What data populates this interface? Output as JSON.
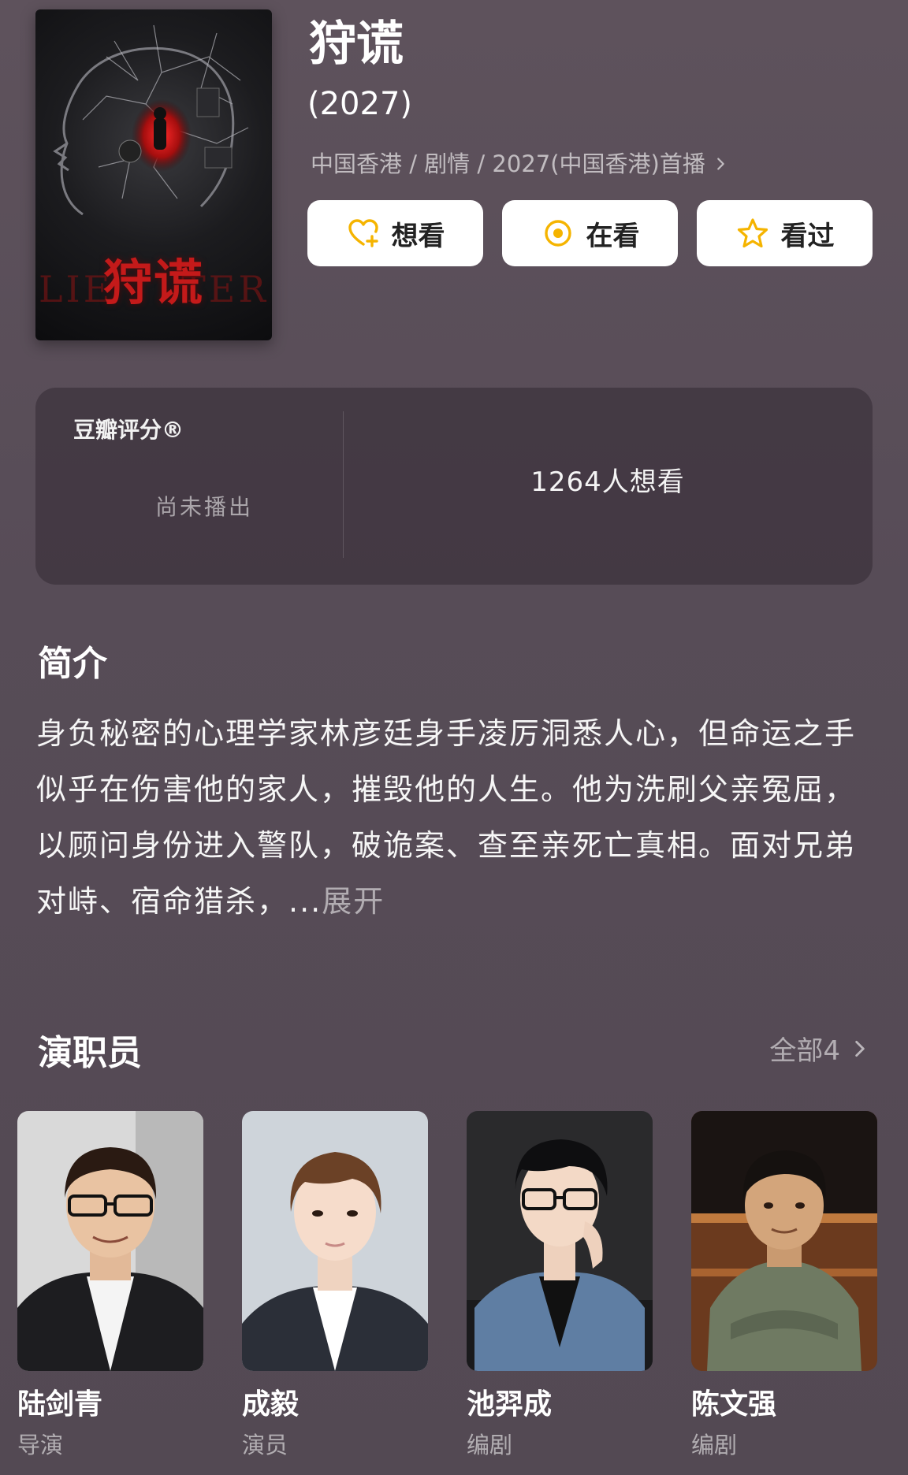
{
  "movie": {
    "title": "狩谎",
    "year": "(2027)",
    "meta": "中国香港 / 剧情 / 2027(中国香港)首播",
    "poster": {
      "title": "狩谎",
      "en_left": "LIE",
      "en_right": "TER"
    }
  },
  "actions": [
    {
      "label": "想看",
      "icon": "heart-plus-icon"
    },
    {
      "label": "在看",
      "icon": "target-icon"
    },
    {
      "label": "看过",
      "icon": "star-icon"
    }
  ],
  "rating": {
    "label": "豆瓣评分®",
    "status": "尚未播出",
    "wish_count": "1264人想看"
  },
  "intro": {
    "title": "简介",
    "text": "身负秘密的心理学家林彦廷身手凌厉洞悉人心，但命运之手似乎在伤害他的家人，摧毁他的人生。他为洗刷父亲冤屈，以顾问身份进入警队，破诡案、查至亲死亡真相。面对兄弟对峙、宿命猎杀，...",
    "more": "展开"
  },
  "cast": {
    "title": "演职员",
    "all_label": "全部4",
    "members": [
      {
        "name": "陆剑青",
        "role": "导演"
      },
      {
        "name": "成毅",
        "role": "演员"
      },
      {
        "name": "池羿成",
        "role": "编剧"
      },
      {
        "name": "陈文强",
        "role": "编剧"
      }
    ]
  },
  "colors": {
    "background": "#574c57",
    "accent": "#f5b400",
    "poster_red": "#c41a1a"
  }
}
